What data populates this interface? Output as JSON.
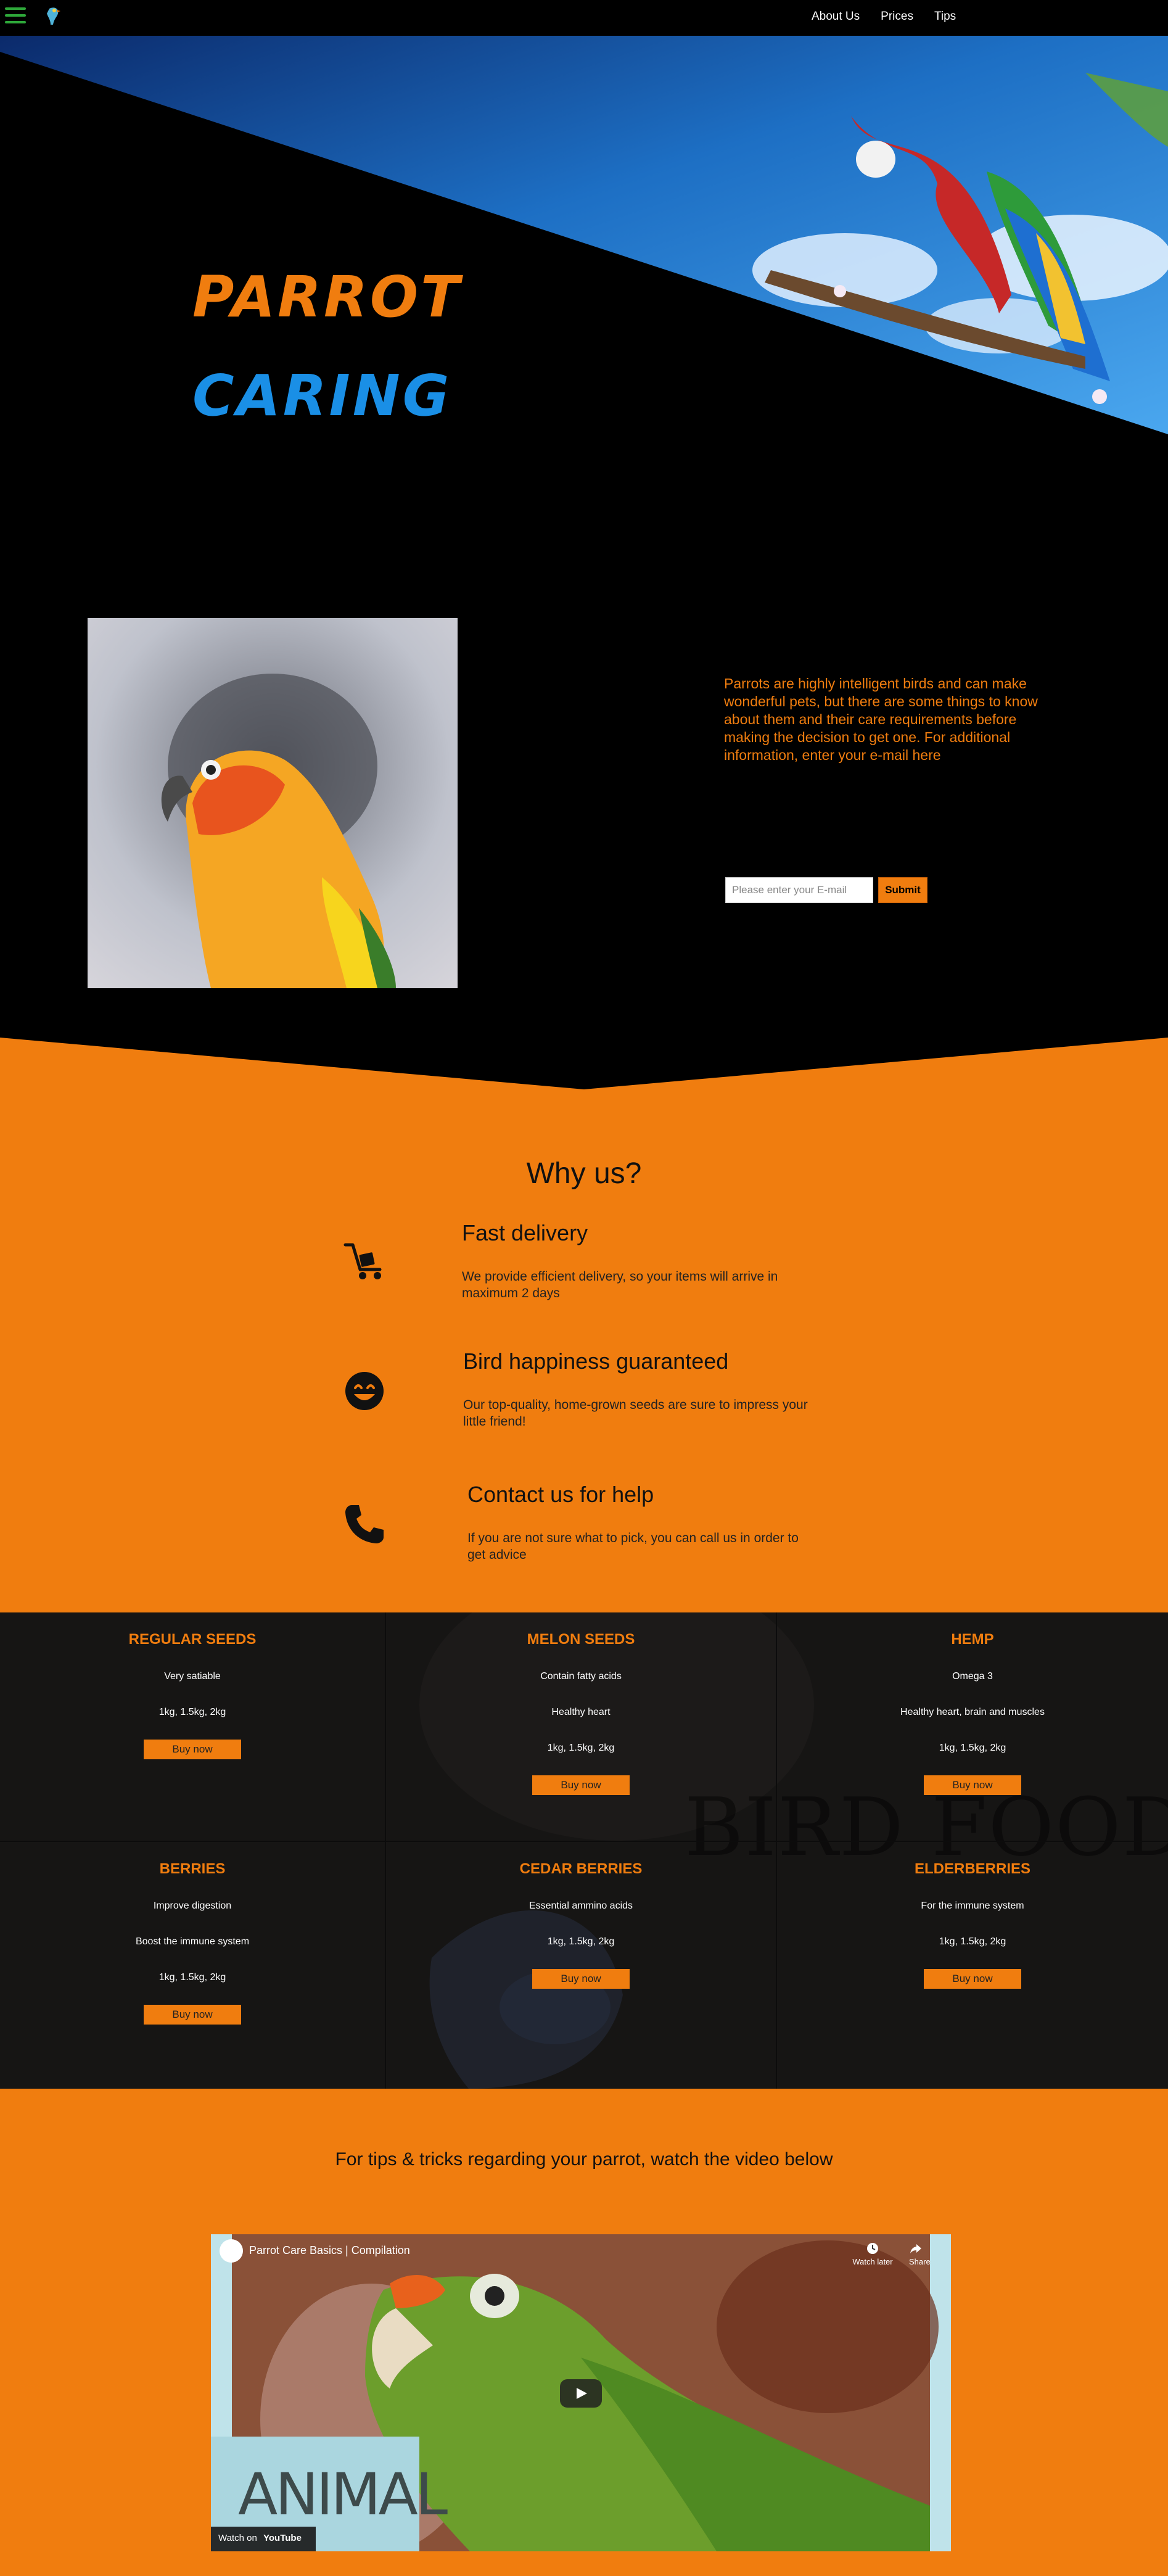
{
  "nav": {
    "menu_icon": "hamburger-menu-icon",
    "logo_icon": "parrot-logo-icon",
    "links": [
      "About Us",
      "Prices",
      "Tips"
    ]
  },
  "hero": {
    "title_line1": "PARROT",
    "title_line2": "CARING",
    "title1_color": "#f07d0f",
    "title2_color": "#1a8fe6"
  },
  "intro": {
    "text": "Parrots are highly intelligent birds and can make wonderful pets, but there are some things to know about them and their care requirements before making the decision to get one. For additional information, enter your e-mail here",
    "email_placeholder": "Please enter your E-mail",
    "submit_label": "Submit"
  },
  "why": {
    "title": "Why us?",
    "features": [
      {
        "icon": "delivery-cart-icon",
        "title": "Fast delivery",
        "desc": "We provide efficient delivery, so your items will arrive in maximum 2 days"
      },
      {
        "icon": "smiley-face-icon",
        "title": "Bird happiness guaranteed",
        "desc": "Our top-quality, home-grown seeds are sure to impress your little friend!"
      },
      {
        "icon": "phone-icon",
        "title": "Contact us for help",
        "desc": "If you are not sure what to pick, you can call us in order to get advice"
      }
    ]
  },
  "products": {
    "background_word": "BIRD FOOD",
    "buy_label": "Buy now",
    "items": [
      {
        "name": "REGULAR SEEDS",
        "lines": [
          "Very satiable",
          "1kg, 1.5kg, 2kg"
        ]
      },
      {
        "name": "MELON SEEDS",
        "lines": [
          "Contain fatty acids",
          "Healthy heart",
          "1kg, 1.5kg, 2kg"
        ]
      },
      {
        "name": "HEMP",
        "lines": [
          "Omega 3",
          "Healthy heart, brain and muscles",
          "1kg, 1.5kg, 2kg"
        ]
      },
      {
        "name": "BERRIES",
        "lines": [
          "Improve digestion",
          "Boost the immune system",
          "1kg, 1.5kg, 2kg"
        ]
      },
      {
        "name": "CEDAR BERRIES",
        "lines": [
          "Essential ammino acids",
          "1kg, 1.5kg, 2kg"
        ]
      },
      {
        "name": "ELDERBERRIES",
        "lines": [
          "For the immune system",
          "1kg, 1.5kg, 2kg"
        ]
      }
    ]
  },
  "video": {
    "heading": "For tips & tricks regarding your parrot, watch the video below",
    "title": "Parrot Care Basics | Compilation",
    "watch_later": "Watch later",
    "share": "Share",
    "watch_on": "Watch on",
    "youtube": "YouTube",
    "animal_text": "ANIMAL"
  },
  "colors": {
    "accent": "#f07d0f",
    "blue": "#1a8fe6",
    "background": "#000000",
    "products_bg": "#161514"
  }
}
